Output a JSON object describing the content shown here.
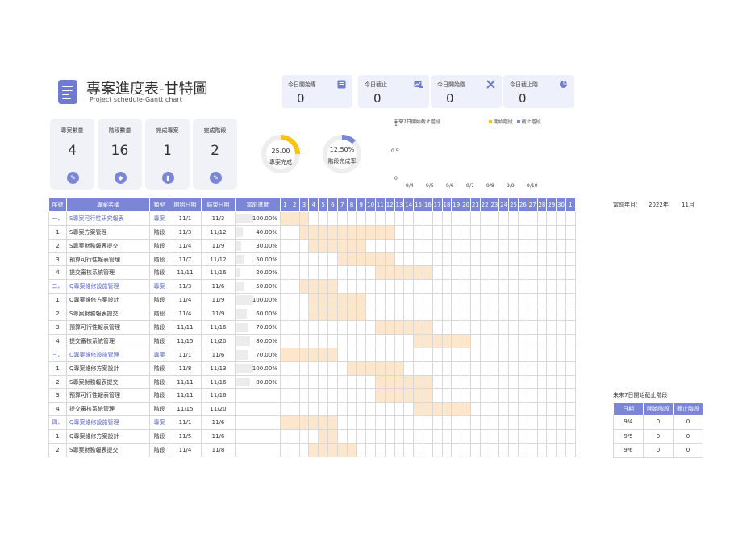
{
  "header": {
    "title": "專案進度表-甘特圖",
    "subtitle": "Project schedule-Gantt chart",
    "logo_icon": "document-chart-icon"
  },
  "today_cards": [
    {
      "label": "今日開始專",
      "value": "0",
      "icon": "list-icon"
    },
    {
      "label": "今日截止",
      "value": "0",
      "icon": "chart-edit-icon"
    },
    {
      "label": "今日開始階",
      "value": "0",
      "icon": "tools-icon"
    },
    {
      "label": "今日截止階",
      "value": "0",
      "icon": "pie-icon"
    }
  ],
  "stats": [
    {
      "label": "專案數量",
      "value": "4",
      "icon": "edit-icon"
    },
    {
      "label": "階段數量",
      "value": "16",
      "icon": "tag-icon"
    },
    {
      "label": "完成專案",
      "value": "1",
      "icon": "bar-chart-icon"
    },
    {
      "label": "完成階段",
      "value": "2",
      "icon": "edit-icon"
    }
  ],
  "donuts": [
    {
      "value": "25.00",
      "percent": 25.0,
      "label": "專案完成",
      "color": "#f5c518"
    },
    {
      "value": "12.50%",
      "percent": 12.5,
      "label": "階段完成率",
      "color": "#7b86d6"
    }
  ],
  "chart_data": {
    "type": "bar",
    "title": "未來7日開始截止階段",
    "categories": [
      "9/4",
      "9/5",
      "9/6",
      "9/7",
      "9/8",
      "9/9",
      "9/10"
    ],
    "series": [
      {
        "name": "開始階段",
        "values": [
          0,
          0,
          0,
          0,
          0,
          0,
          0
        ],
        "color": "#f5c518"
      },
      {
        "name": "截止階段",
        "values": [
          0,
          0,
          0,
          0,
          0,
          0,
          0
        ],
        "color": "#7b86d6"
      }
    ],
    "yticks": [
      "1",
      "0.5",
      "0"
    ],
    "ylim": [
      0,
      1
    ]
  },
  "table": {
    "headers": [
      "序號",
      "專案名稱",
      "類型",
      "開始日期",
      "結束日期",
      "當前進度"
    ],
    "days": [
      "1",
      "2",
      "3",
      "4",
      "5",
      "6",
      "7",
      "8",
      "9",
      "10",
      "11",
      "12",
      "13",
      "14",
      "15",
      "16",
      "17",
      "18",
      "19",
      "20",
      "21",
      "22",
      "23",
      "24",
      "25",
      "26",
      "27",
      "28",
      "29",
      "30",
      "1"
    ],
    "rows": [
      {
        "idx": "一、",
        "name": "S專案可行性研究報表",
        "type": "專案",
        "start": "11/1",
        "end": "11/3",
        "progress": "100.00%",
        "pct": 100,
        "project": true,
        "s": 1,
        "e": 3
      },
      {
        "idx": "1",
        "name": "S專案方案管理",
        "type": "階段",
        "start": "11/3",
        "end": "11/12",
        "progress": "40.00%",
        "pct": 40,
        "project": false,
        "s": 3,
        "e": 12
      },
      {
        "idx": "2",
        "name": "S專案財務報表提交",
        "type": "階段",
        "start": "11/4",
        "end": "11/9",
        "progress": "30.00%",
        "pct": 30,
        "project": false,
        "s": 4,
        "e": 9
      },
      {
        "idx": "3",
        "name": "預算可行性報表管理",
        "type": "階段",
        "start": "11/7",
        "end": "11/12",
        "progress": "50.00%",
        "pct": 50,
        "project": false,
        "s": 7,
        "e": 12
      },
      {
        "idx": "4",
        "name": "提交審核系統管理",
        "type": "階段",
        "start": "11/11",
        "end": "11/16",
        "progress": "20.00%",
        "pct": 20,
        "project": false,
        "s": 11,
        "e": 16
      },
      {
        "idx": "二、",
        "name": "Q專案維修設施管理",
        "type": "專案",
        "start": "11/3",
        "end": "11/6",
        "progress": "50.00%",
        "pct": 50,
        "project": true,
        "s": 3,
        "e": 6
      },
      {
        "idx": "1",
        "name": "Q專案維修方案設計",
        "type": "階段",
        "start": "11/4",
        "end": "11/9",
        "progress": "100.00%",
        "pct": 100,
        "project": false,
        "s": 4,
        "e": 9
      },
      {
        "idx": "2",
        "name": "S專案財務報表提交",
        "type": "階段",
        "start": "11/4",
        "end": "11/9",
        "progress": "60.00%",
        "pct": 60,
        "project": false,
        "s": 4,
        "e": 9
      },
      {
        "idx": "3",
        "name": "預算可行性報表管理",
        "type": "階段",
        "start": "11/11",
        "end": "11/16",
        "progress": "70.00%",
        "pct": 70,
        "project": false,
        "s": 11,
        "e": 16
      },
      {
        "idx": "4",
        "name": "提交審核系統管理",
        "type": "階段",
        "start": "11/15",
        "end": "11/20",
        "progress": "80.00%",
        "pct": 80,
        "project": false,
        "s": 15,
        "e": 20
      },
      {
        "idx": "三、",
        "name": "Q專案維修設施管理",
        "type": "專案",
        "start": "11/1",
        "end": "11/6",
        "progress": "70.00%",
        "pct": 70,
        "project": true,
        "s": 1,
        "e": 6
      },
      {
        "idx": "1",
        "name": "Q專案維修方案設計",
        "type": "階段",
        "start": "11/8",
        "end": "11/13",
        "progress": "100.00%",
        "pct": 100,
        "project": false,
        "s": 8,
        "e": 13
      },
      {
        "idx": "2",
        "name": "S專案財務報表提交",
        "type": "階段",
        "start": "11/11",
        "end": "11/16",
        "progress": "80.00%",
        "pct": 80,
        "project": false,
        "s": 11,
        "e": 16
      },
      {
        "idx": "3",
        "name": "預算可行性報表管理",
        "type": "階段",
        "start": "11/11",
        "end": "11/16",
        "progress": "",
        "pct": 0,
        "project": false,
        "s": 11,
        "e": 16
      },
      {
        "idx": "4",
        "name": "提交審核系統管理",
        "type": "階段",
        "start": "11/15",
        "end": "11/20",
        "progress": "",
        "pct": 0,
        "project": false,
        "s": 15,
        "e": 20
      },
      {
        "idx": "四、",
        "name": "Q專案維修設施管理",
        "type": "專案",
        "start": "11/1",
        "end": "11/6",
        "progress": "",
        "pct": 0,
        "project": true,
        "s": 1,
        "e": 6
      },
      {
        "idx": "1",
        "name": "Q專案維修方案設計",
        "type": "階段",
        "start": "11/5",
        "end": "11/6",
        "progress": "",
        "pct": 0,
        "project": false,
        "s": 5,
        "e": 6
      },
      {
        "idx": "2",
        "name": "S專案財務報表提交",
        "type": "階段",
        "start": "11/4",
        "end": "11/8",
        "progress": "",
        "pct": 0,
        "project": false,
        "s": 4,
        "e": 8
      }
    ]
  },
  "current_month": {
    "label": "當前年月：",
    "year": "2022年",
    "month": "11月"
  },
  "next7": {
    "title": "未來7日開始截止階段",
    "headers": [
      "日期",
      "開始階段",
      "截止階段"
    ],
    "rows": [
      [
        "9/4",
        "0",
        "0"
      ],
      [
        "9/5",
        "0",
        "0"
      ],
      [
        "9/6",
        "0",
        "0"
      ]
    ]
  }
}
